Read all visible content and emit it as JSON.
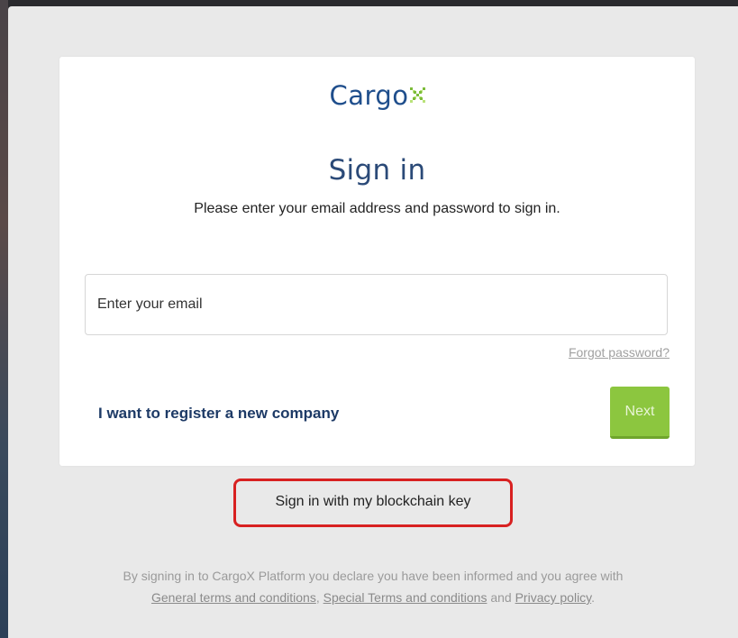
{
  "logo": {
    "text": "Cargo",
    "mark": "x-mark-icon",
    "colors": {
      "text": "#1f4e8c",
      "mark_light": "#b9e27a",
      "mark_dark": "#7cbc3a"
    }
  },
  "signin": {
    "title": "Sign in",
    "subtitle": "Please enter your email address and password to sign in.",
    "email_placeholder": "Enter your email",
    "forgot_password": "Forgot password?",
    "register_link": "I want to register a new company",
    "next_button": "Next"
  },
  "blockchain": {
    "label": "Sign in with my blockchain key",
    "highlight_color": "#d82121"
  },
  "footer": {
    "line1": "By signing in to CargoX Platform you declare you have been informed and you agree with",
    "general_terms": "General terms and conditions",
    "comma": ",",
    "special_terms": "Special Terms and conditions",
    "and": "and",
    "privacy": "Privacy policy",
    "period": "."
  },
  "colors": {
    "accent_green": "#8cc63f",
    "brand_blue": "#1d3a66",
    "page_bg": "#e9e9e9"
  }
}
